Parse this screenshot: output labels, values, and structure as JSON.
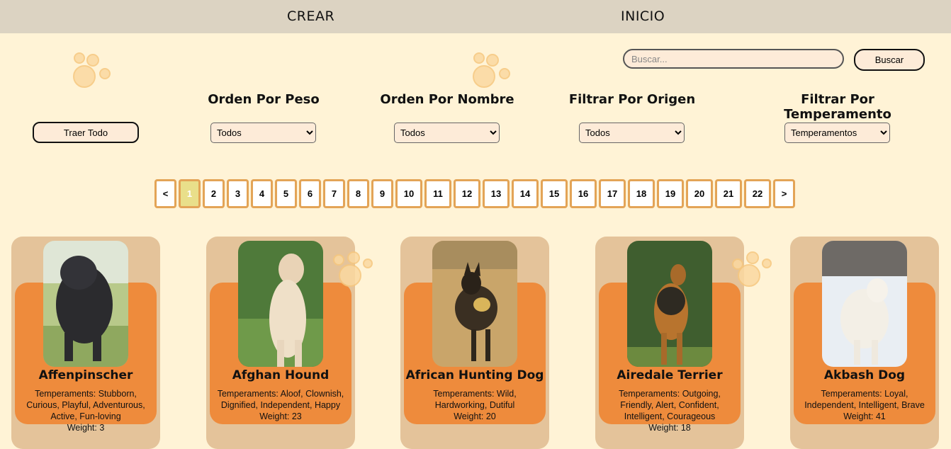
{
  "nav": {
    "crear": "CREAR",
    "inicio": "INICIO"
  },
  "search": {
    "placeholder": "Buscar...",
    "button": "Buscar"
  },
  "traer_todo": "Traer Todo",
  "filters": [
    {
      "title": "Orden Por Peso",
      "selected": "Todos"
    },
    {
      "title": "Orden Por Nombre",
      "selected": "Todos"
    },
    {
      "title": "Filtrar Por Origen",
      "selected": "Todos"
    },
    {
      "title": "Filtrar Por Temperamento",
      "selected": "Temperamentos"
    }
  ],
  "pagination": {
    "prev": "<",
    "next": ">",
    "pages": [
      "1",
      "2",
      "3",
      "4",
      "5",
      "6",
      "7",
      "8",
      "9",
      "10",
      "11",
      "12",
      "13",
      "14",
      "15",
      "16",
      "17",
      "18",
      "19",
      "20",
      "21",
      "22"
    ],
    "current": "1"
  },
  "cards": [
    {
      "name": "Affenpinscher",
      "temperaments": "Temperaments: Stubborn, Curious, Playful, Adventurous, Active, Fun-loving",
      "weight": "Weight: 3"
    },
    {
      "name": "Afghan Hound",
      "temperaments": "Temperaments: Aloof, Clownish, Dignified, Independent, Happy",
      "weight": "Weight: 23"
    },
    {
      "name": "African Hunting Dog",
      "temperaments": "Temperaments: Wild, Hardworking, Dutiful",
      "weight": "Weight: 20"
    },
    {
      "name": "Airedale Terrier",
      "temperaments": "Temperaments: Outgoing, Friendly, Alert, Confident, Intelligent, Courageous",
      "weight": "Weight: 18"
    },
    {
      "name": "Akbash Dog",
      "temperaments": "Temperaments: Loyal, Independent, Intelligent, Brave",
      "weight": "Weight: 41"
    }
  ],
  "colors": {
    "background": "#fff3d6",
    "topbar": "#dcd3c2",
    "card_outer": "#e4c39a",
    "card_inner": "#ee8b3c",
    "page_border": "#e3a457",
    "page_active": "#e9df8a"
  }
}
